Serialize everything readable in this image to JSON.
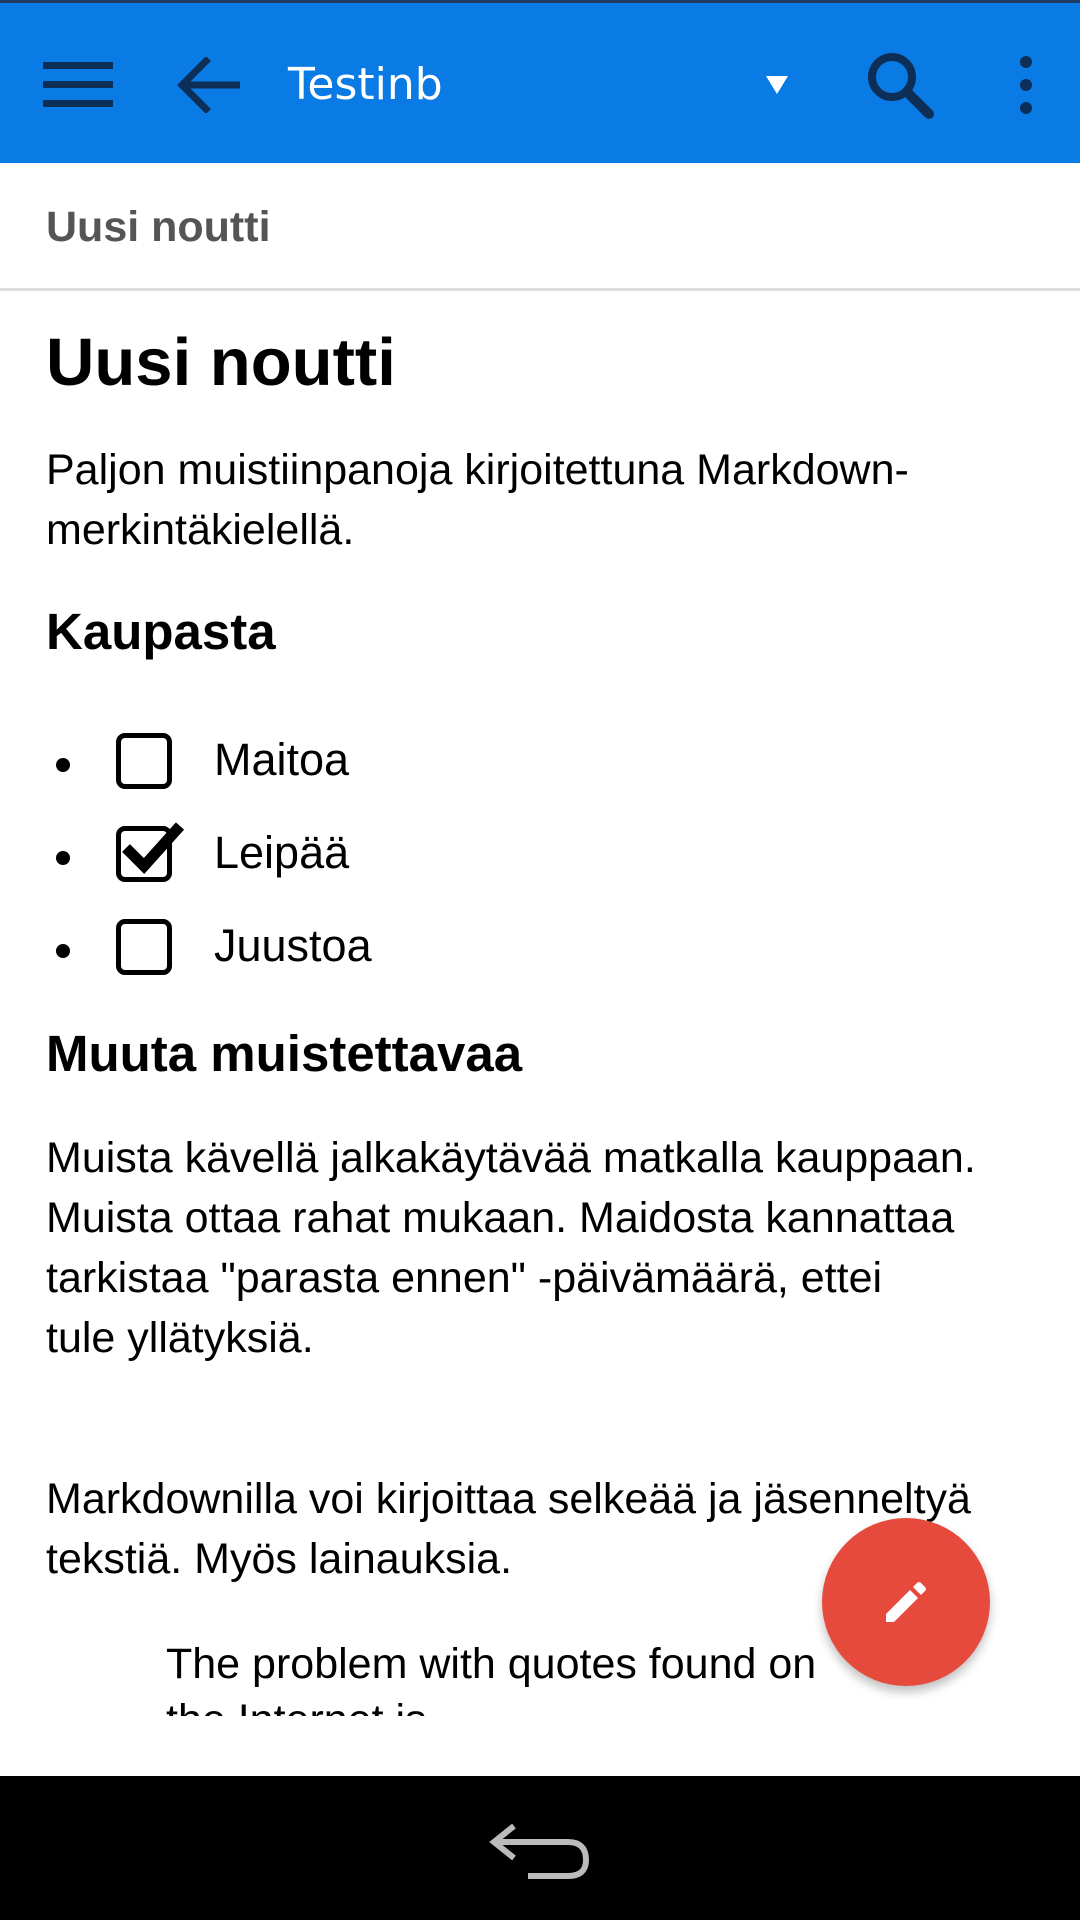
{
  "appbar": {
    "title": "Testinb",
    "bg_color": "#0a7be5",
    "icons": [
      "menu-icon",
      "arrow-back-icon",
      "dropdown-triangle-icon",
      "search-icon",
      "more-vert-icon"
    ]
  },
  "subheader": {
    "title": "Uusi noutti"
  },
  "note": {
    "heading": "Uusi noutti",
    "intro": "Paljon muistiinpanoja kirjoitettuna Markdown-merkintäkielellä.",
    "section1_heading": "Kaupasta",
    "checklist": [
      {
        "label": "Maitoa",
        "checked": false
      },
      {
        "label": "Leipää",
        "checked": true
      },
      {
        "label": "Juustoa",
        "checked": false
      }
    ],
    "section2_heading": "Muuta muistettavaa",
    "para2_line1": "Muista kävellä jalkakäytävää matkalla kauppaan. Muista ottaa rahat mukaan. Maidosta kannattaa tarkistaa \"parasta ennen\" -päivämäärä, ettei",
    "para2_line2": "tule yllätyksiä.",
    "para3": "Markdownilla voi kirjoittaa selkeää ja jäsenneltyä tekstiä. Myös lainauksia.",
    "quote": "The problem with quotes found on the Internet is"
  },
  "fab": {
    "icon": "pencil-edit-icon",
    "color": "#e64a3c"
  },
  "navbar": {
    "icon": "nav-back-icon"
  }
}
